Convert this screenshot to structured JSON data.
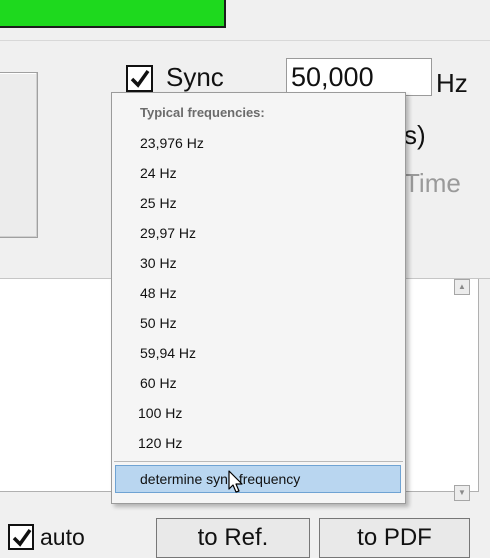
{
  "sync": {
    "label": "Sync",
    "checked": true,
    "frequency_value": "50,000",
    "unit": "Hz"
  },
  "partial_labels": {
    "seconds": "s)",
    "time": "Time"
  },
  "bottom": {
    "auto_label": "auto",
    "to_ref_label": "to Ref.",
    "to_pdf_label": "to PDF"
  },
  "dropdown": {
    "header": "Typical frequencies:",
    "items": [
      "23,976 Hz",
      "24 Hz",
      "25 Hz",
      "29,97 Hz",
      "30 Hz",
      "48 Hz",
      "50 Hz",
      "59,94 Hz",
      "60 Hz",
      "100 Hz",
      "120 Hz"
    ],
    "action": "determine sync frequency"
  },
  "icons": {
    "scroll_up": "scroll-up-arrow-icon",
    "scroll_down": "scroll-down-arrow-icon",
    "cursor": "mouse-pointer-icon"
  }
}
